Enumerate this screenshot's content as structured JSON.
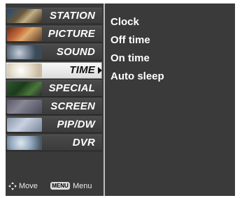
{
  "menu": {
    "items": [
      {
        "label": "STATION",
        "icon": "station-thumbnail-icon"
      },
      {
        "label": "PICTURE",
        "icon": "picture-thumbnail-icon"
      },
      {
        "label": "SOUND",
        "icon": "sound-thumbnail-icon"
      },
      {
        "label": "TIME",
        "icon": "time-thumbnail-icon",
        "selected": true
      },
      {
        "label": "SPECIAL",
        "icon": "special-thumbnail-icon"
      },
      {
        "label": "SCREEN",
        "icon": "screen-thumbnail-icon"
      },
      {
        "label": "PIP/DW",
        "icon": "pip-dw-thumbnail-icon"
      },
      {
        "label": "DVR",
        "icon": "dvr-thumbnail-icon"
      }
    ]
  },
  "submenu": {
    "items": [
      "Clock",
      "Off time",
      "On time",
      "Auto sleep"
    ]
  },
  "footer": {
    "move_label": "Move",
    "menu_key_label": "MENU",
    "menu_label": "Menu"
  },
  "colors": {
    "panel_bg": "#3a3a3a",
    "selected_bg": "#f0f0f0",
    "text": "#ffffff"
  }
}
